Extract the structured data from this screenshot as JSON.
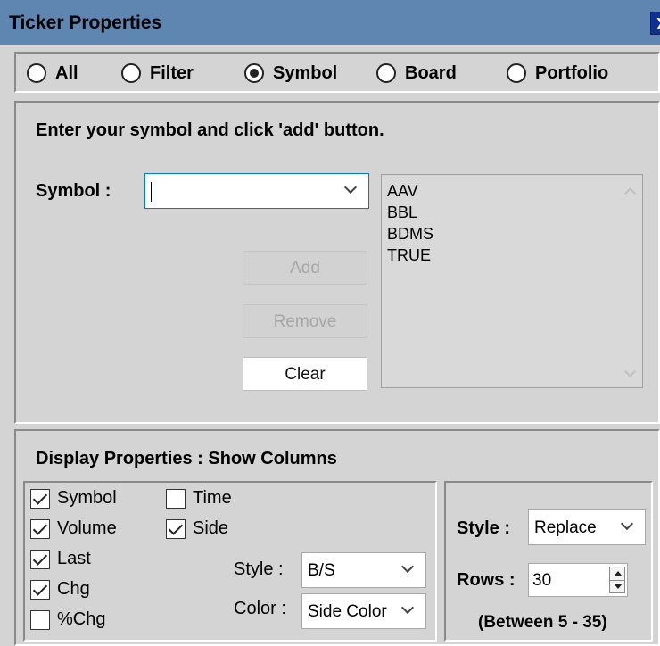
{
  "window": {
    "title": "Ticker Properties",
    "close_label": "X"
  },
  "source_options": [
    {
      "label": "All",
      "selected": false
    },
    {
      "label": "Filter",
      "selected": false
    },
    {
      "label": "Symbol",
      "selected": true
    },
    {
      "label": "Board",
      "selected": false
    },
    {
      "label": "Portfolio",
      "selected": false
    }
  ],
  "symbol_panel": {
    "instruction": "Enter your symbol and click 'add' button.",
    "symbol_label": "Symbol :",
    "symbol_input_value": "",
    "symbols": [
      "AAV",
      "BBL",
      "BDMS",
      "TRUE"
    ],
    "add_label": "Add",
    "remove_label": "Remove",
    "clear_label": "Clear"
  },
  "display": {
    "title": "Display Properties :  Show Columns",
    "columns": [
      {
        "label": "Symbol",
        "checked": true
      },
      {
        "label": "Volume",
        "checked": true
      },
      {
        "label": "Last",
        "checked": true
      },
      {
        "label": "Chg",
        "checked": true
      },
      {
        "label": "%Chg",
        "checked": false
      },
      {
        "label": "Time",
        "checked": false
      },
      {
        "label": "Side",
        "checked": true
      }
    ],
    "side_style_label": "Style :",
    "side_style_value": "B/S",
    "side_color_label": "Color :",
    "side_color_value": "Side Color",
    "style_label": "Style :",
    "style_value": "Replace",
    "rows_label": "Rows :",
    "rows_value": "30",
    "rows_range": "(Between 5 - 35)"
  }
}
